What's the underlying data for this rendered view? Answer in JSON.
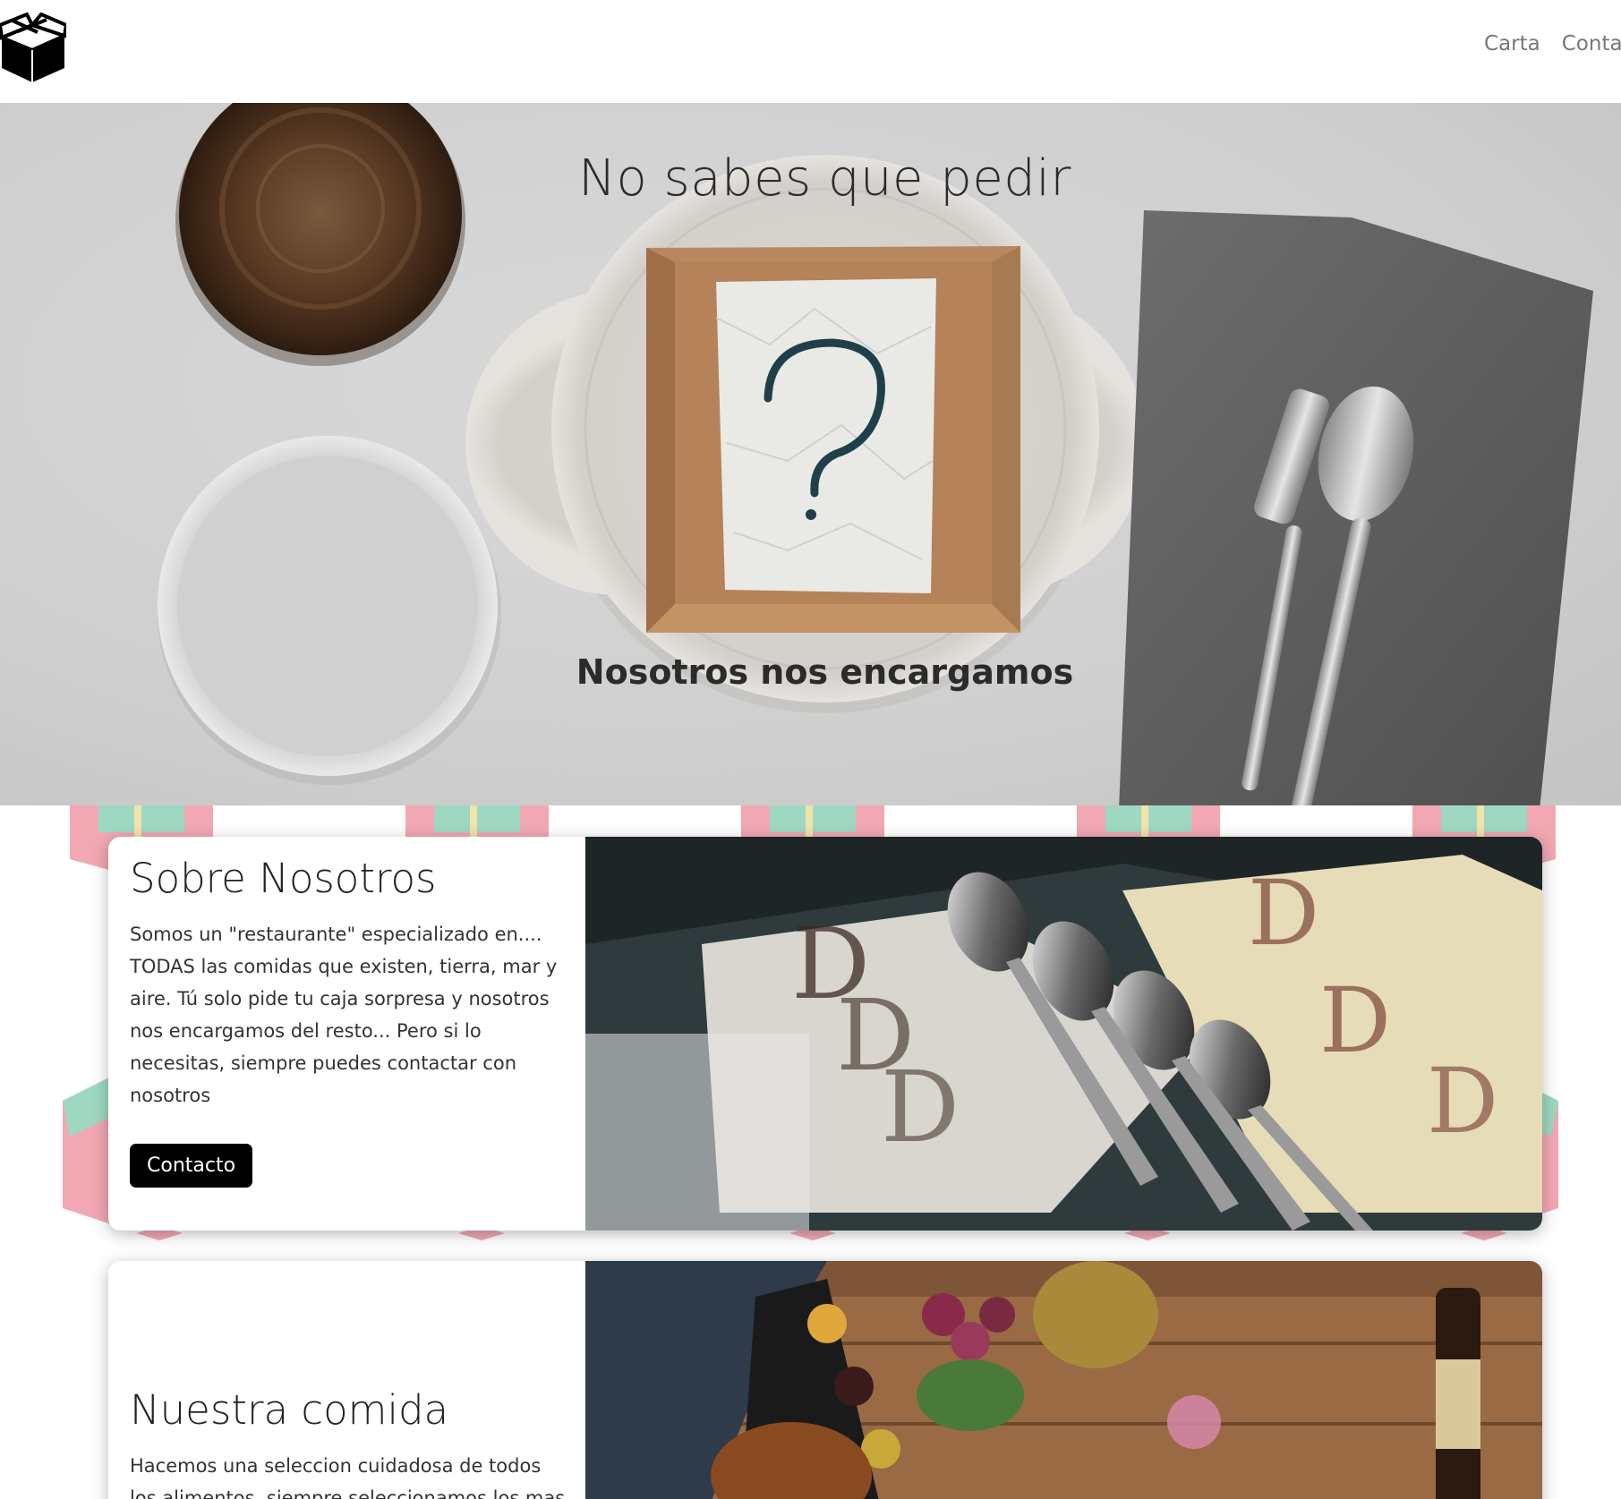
{
  "navbar": {
    "logo_icon": "box-logo-icon",
    "links": [
      "Carta",
      "Conta"
    ]
  },
  "hero": {
    "title": "No sabes que pedir",
    "subtitle": "Nosotros nos encargamos"
  },
  "cards": [
    {
      "title": "Sobre Nosotros",
      "body": "Somos un \"restaurante\" especializado en.... TODAS las comidas que existen, tierra, mar y aire. Tú solo pide tu caja sorpresa y nosotros nos encargamos del resto... Pero si lo necesitas, siempre puedes contactar con nosotros",
      "button": "Contacto"
    },
    {
      "title": "Nuestra comida",
      "body": "Hacemos una seleccion cuidadosa de todos los alimentos, siempre seleccionamos los mas"
    }
  ],
  "colors": {
    "button_bg": "#000000",
    "nav_text": "#777777",
    "pattern_pink": "#f2a8b3",
    "pattern_mint": "#9fd8c2",
    "pattern_cream": "#f1e4a8"
  }
}
